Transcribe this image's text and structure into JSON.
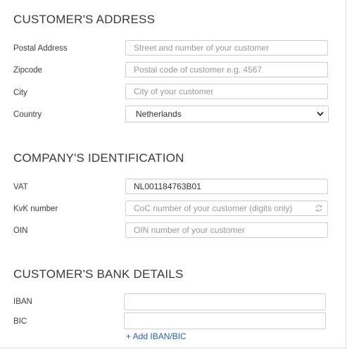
{
  "address": {
    "title": "CUSTOMER'S ADDRESS",
    "postal_label": "Postal Address",
    "postal_placeholder": "Street and number of your customer",
    "zip_label": "Zipcode",
    "zip_placeholder": "Postal code of customer e.g. 4567",
    "city_label": "City",
    "city_placeholder": "City of your customer",
    "country_label": "Country",
    "country_value": "Netherlands"
  },
  "identification": {
    "title": "COMPANY'S IDENTIFICATION",
    "vat_label": "VAT",
    "vat_value": "NL001184763B01",
    "kvk_label": "KvK number",
    "kvk_placeholder": "CoC number of your customer (digits only)",
    "oin_label": "OIN",
    "oin_placeholder": "OIN number of your customer"
  },
  "bank": {
    "title": "CUSTOMER'S BANK DETAILS",
    "iban_label": "IBAN",
    "iban_value": "",
    "bic_label": "BIC",
    "bic_value": "",
    "add_link": "+ Add IBAN/BIC"
  },
  "icons": {
    "country_select": "chevron-down-icon",
    "kvk_lookup": "refresh-icon"
  },
  "colors": {
    "link": "#2a5db0",
    "border": "#cfcfcf"
  }
}
